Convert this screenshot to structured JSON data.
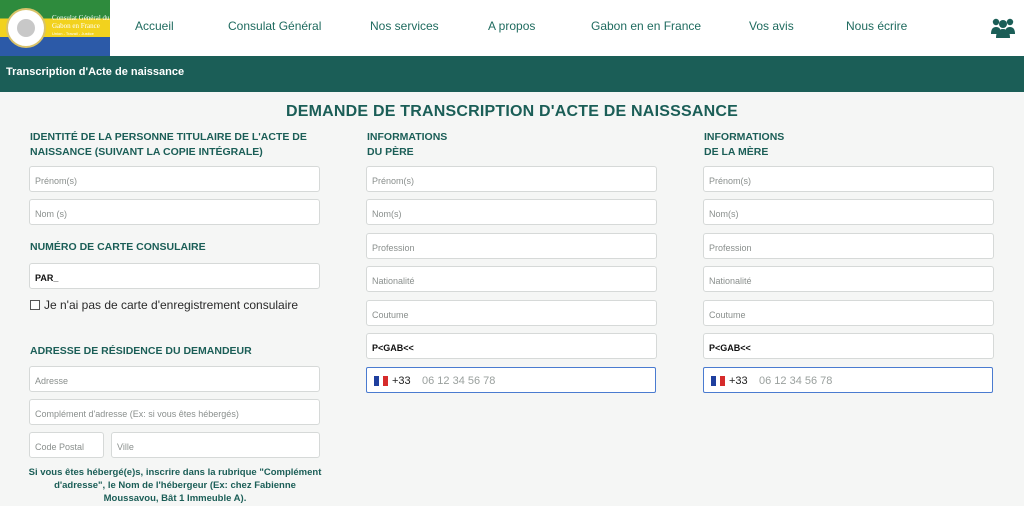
{
  "header": {
    "logo_text": "Consulat Général du Gabon en France",
    "logo_sub": "Union - Travail - Justice",
    "nav": [
      "Accueil",
      "Consulat Général",
      "Nos services",
      "A propos",
      "Gabon en  en France",
      "Vos avis",
      "Nous écrire"
    ],
    "user_icon": "users-icon"
  },
  "breadcrumb_bar": {
    "title": "Transcription d'Acte de naissance"
  },
  "form": {
    "title": "DEMANDE DE TRANSCRIPTION D'ACTE DE NAISSSANCE",
    "titulaire": {
      "heading": "IDENTITÉ DE LA PERSONNE TITULAIRE DE L'ACTE DE NAISSANCE (SUIVANT LA COPIE INTÉGRALE)",
      "prenom_placeholder": "Prénom(s)",
      "nom_placeholder": "Nom (s)"
    },
    "carte": {
      "heading": "NUMÉRO DE CARTE CONSULAIRE",
      "value": "PAR_",
      "checkbox_label": "Je n'ai pas de carte d'enregistrement consulaire"
    },
    "adresse": {
      "heading": "ADRESSE DE RÉSIDENCE DU DEMANDEUR",
      "adresse_placeholder": "Adresse",
      "complement_placeholder": "Complément d'adresse (Ex: si vous êtes hébergés)",
      "cp_placeholder": "Code Postal",
      "ville_placeholder": "Ville",
      "note": "Si vous êtes hébergé(e)s, inscrire dans la rubrique \"Complément d'adresse\", le Nom de l'hébergeur (Ex: chez Fabienne Moussavou, Bât 1 Immeuble A)."
    },
    "pere": {
      "heading_line1": "INFORMATIONS",
      "heading_line2": "DU PÈRE",
      "prenom_placeholder": "Prénom(s)",
      "nom_placeholder": "Nom(s)",
      "profession_placeholder": "Profession",
      "nationalite_placeholder": "Nationalité",
      "coutume_placeholder": "Coutume",
      "mrz_value": "P<GAB<<",
      "dial_code": "+33",
      "phone_placeholder": "06 12 34 56 78"
    },
    "mere": {
      "heading_line1": "INFORMATIONS",
      "heading_line2": "DE LA MÈRE",
      "prenom_placeholder": "Prénom(s)",
      "nom_placeholder": "Nom(s)",
      "profession_placeholder": "Profession",
      "nationalite_placeholder": "Nationalité",
      "coutume_placeholder": "Coutume",
      "mrz_value": "P<GAB<<",
      "dial_code": "+33",
      "phone_placeholder": "06 12 34 56 78"
    }
  },
  "colors": {
    "primary": "#1b5e57",
    "background": "#f5f6f5",
    "phone_border": "#4a7bd0"
  }
}
